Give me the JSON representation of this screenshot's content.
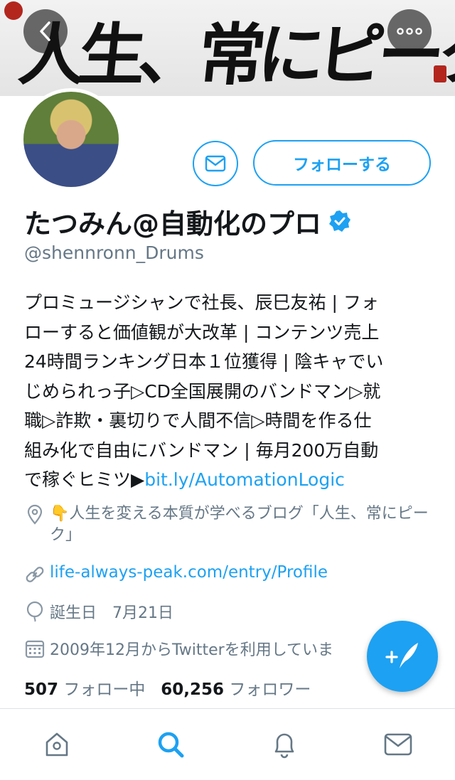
{
  "banner": {
    "title": "人生、常にピーク"
  },
  "profile": {
    "name": "たつみん@自動化のプロ",
    "handle": "@shennronn_Drums",
    "follow_label": "フォローする",
    "bio_lines": [
      "プロミュージシャンで社長、辰巳友祐 | フォ",
      "ローすると価値観が大改革 | コンテンツ売上",
      "24時間ランキング日本１位獲得 | 陰キャでい",
      "じめられっ子▷CD全国展開のバンドマン▷就",
      "職▷詐欺・裏切りで人間不信▷時間を作る仕",
      "組み化で自由にバンドマン | 毎月200万自動"
    ],
    "bio_last_prefix": "で稼ぐヒミツ▶",
    "bio_link": "bit.ly/AutomationLogic",
    "location": "👇人生を変える本質が学べるブログ「人生、常にピーク」",
    "website": "life-always-peak.com/entry/Profile",
    "birthday": "誕生日　7月21日",
    "joined": "2009年12月からTwitterを利用していま",
    "following_count": "507",
    "following_label": "フォロー中",
    "followers_count": "60,256",
    "followers_label": "フォロワー"
  },
  "colors": {
    "accent": "#1da1f2",
    "muted": "#657786"
  },
  "icons": [
    "back-icon",
    "more-icon",
    "mail-icon",
    "verified-badge-icon",
    "location-icon",
    "link-icon",
    "birthday-icon",
    "calendar-icon",
    "compose-icon",
    "home-icon",
    "search-icon",
    "notifications-icon",
    "messages-icon"
  ]
}
